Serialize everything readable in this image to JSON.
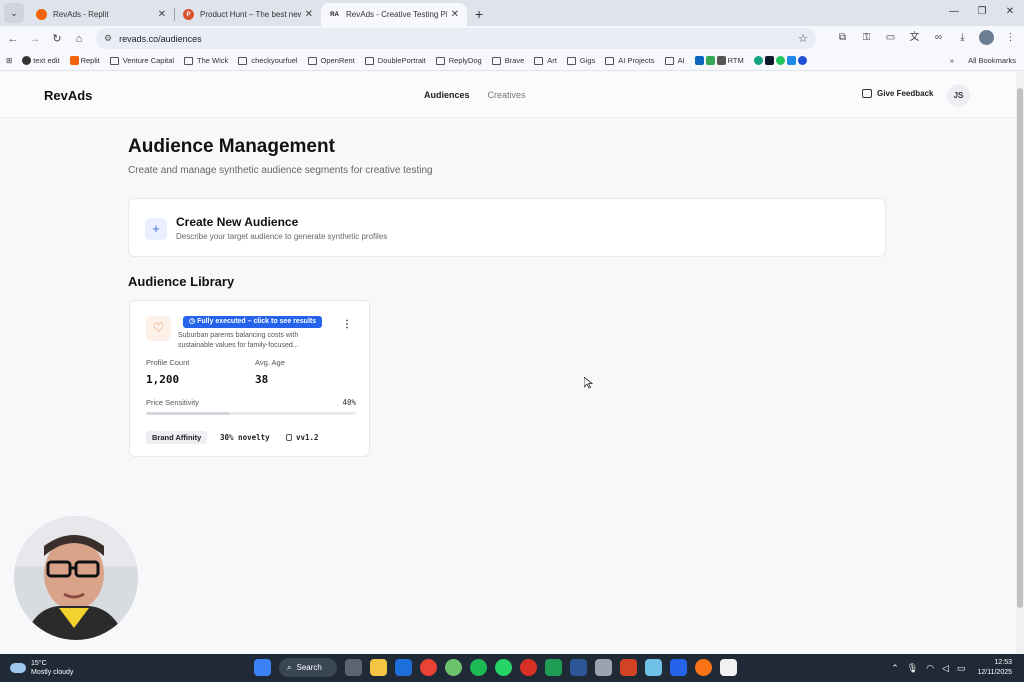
{
  "browser": {
    "tabs": [
      {
        "title": "RevAds - Replit",
        "active": false,
        "color": "#f26207"
      },
      {
        "title": "Product Hunt – The best new p",
        "active": false,
        "color": "#da552f"
      },
      {
        "title": "RevAds - Creative Testing Platfo",
        "active": true,
        "color": "#111111",
        "fav_text": "RA"
      }
    ],
    "url": "revads.co/audiences",
    "bookmarks": [
      "text edit",
      "Replit",
      "Venture Capital",
      "The Wick",
      "checkyourfuel",
      "OpenRent",
      "DoublePortrait",
      "ReplyDog",
      "Brave",
      "Art",
      "Gigs",
      "AI Projects",
      "AI",
      "RTM"
    ],
    "all_bookmarks": "All Bookmarks"
  },
  "app": {
    "logo": "RevAds",
    "nav": [
      "Audiences",
      "Creatives"
    ],
    "feedback": "Give Feedback",
    "avatar": "JS"
  },
  "page": {
    "title": "Audience Management",
    "subtitle": "Create and manage synthetic audience segments for creative testing",
    "create": {
      "title": "Create New Audience",
      "subtitle": "Describe your target audience to generate synthetic profiles"
    },
    "library_title": "Audience Library",
    "audience": {
      "status": "Fully executed – click to see results",
      "description": "Suburban parents balancing costs with sustainable values for family-focused...",
      "profile_count_label": "Profile Count",
      "profile_count": "1,200",
      "avg_age_label": "Avg. Age",
      "avg_age": "38",
      "price_sensitivity_label": "Price Sensitivity",
      "price_sensitivity": "40%",
      "price_sensitivity_value": 0.4,
      "brand_tag": "Brand Affinity",
      "novelty": "30% novelty",
      "version": "vv1.2"
    }
  },
  "taskbar": {
    "temp": "15°C",
    "weather": "Mostly cloudy",
    "search": "Search",
    "time": "12:53",
    "date": "12/11/2025"
  },
  "colors": {
    "accent": "#2563eb",
    "heart": "#e07a3c"
  }
}
